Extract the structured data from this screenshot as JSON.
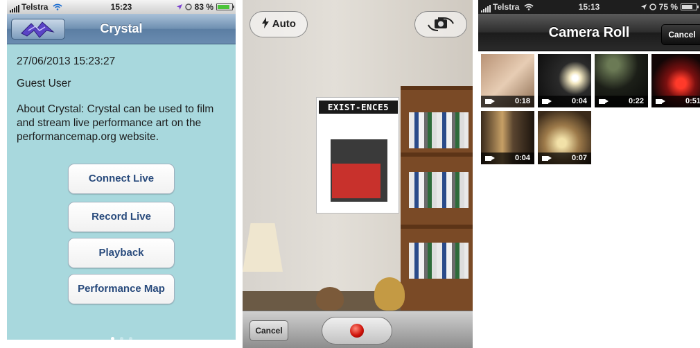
{
  "screen1": {
    "status": {
      "carrier": "Telstra",
      "time": "15:23",
      "battery": "83 %"
    },
    "nav_title": "Crystal",
    "datetime": "27/06/2013 15:23:27",
    "user": "Guest User",
    "about": "About Crystal: Crystal can be used to film and stream live performance art on the performancemap.org website.",
    "buttons": [
      "Connect Live",
      "Record Live",
      "Playback",
      "Performance Map"
    ],
    "page_dots": 3,
    "active_page": 0,
    "colors": {
      "background": "#a8d8dd",
      "nav": "#6a8cb0",
      "button_text": "#284a7c"
    }
  },
  "screen2": {
    "flash_label": "Auto",
    "poster_text": "EXIST-ENCE5",
    "cancel_label": "Cancel",
    "record_color": "#d0140b"
  },
  "screen3": {
    "status": {
      "carrier": "Telstra",
      "time": "15:13",
      "battery": "75 %"
    },
    "nav_title": "Camera Roll",
    "cancel_label": "Cancel",
    "videos": [
      {
        "duration": "0:18"
      },
      {
        "duration": "0:04"
      },
      {
        "duration": "0:22"
      },
      {
        "duration": "0:51"
      },
      {
        "duration": "0:04"
      },
      {
        "duration": "0:07"
      }
    ]
  },
  "icons": [
    "signal-bars-icon",
    "wifi-icon",
    "location-arrow-icon",
    "battery-icon",
    "crystal-logo-icon",
    "flash-icon",
    "camera-flip-icon",
    "record-dot-icon",
    "video-camera-icon"
  ]
}
